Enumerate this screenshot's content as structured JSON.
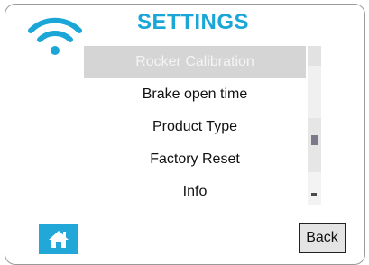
{
  "header": {
    "title": "SETTINGS",
    "status_icon": "wifi-icon",
    "accent_color": "#1aa7d8"
  },
  "menu": {
    "items": [
      {
        "label": "Rocker Calibration",
        "selected": true
      },
      {
        "label": "Brake open time",
        "selected": false
      },
      {
        "label": "Product Type",
        "selected": false
      },
      {
        "label": "Factory Reset",
        "selected": false
      },
      {
        "label": "Info",
        "selected": false
      }
    ]
  },
  "footer": {
    "home_icon": "home-icon",
    "back_label": "Back"
  }
}
